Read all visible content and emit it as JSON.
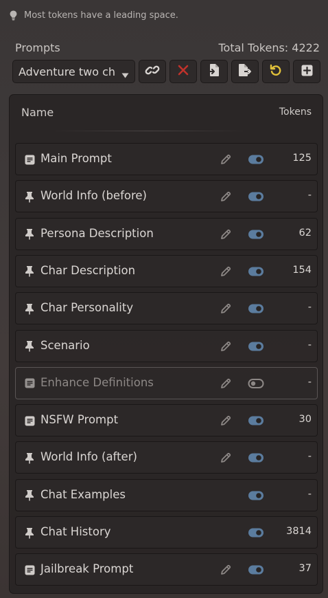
{
  "hint": {
    "text": "Most tokens have a leading space.",
    "icon": "lightbulb-icon"
  },
  "header": {
    "title": "Prompts",
    "total": "Total Tokens: 4222"
  },
  "toolbar": {
    "selected_preset": "Adventure two chars",
    "buttons": [
      {
        "icon": "link-icon",
        "color": "#d8d4d1"
      },
      {
        "icon": "delete-x-icon",
        "color": "#c0322b"
      },
      {
        "icon": "import-file-icon",
        "color": "#d8d4d1"
      },
      {
        "icon": "export-file-icon",
        "color": "#d8d4d1"
      },
      {
        "icon": "reset-undo-icon",
        "color": "#e2c23a"
      },
      {
        "icon": "add-square-icon",
        "color": "#d8d4d1"
      }
    ]
  },
  "table": {
    "name_header": "Name",
    "tokens_header": "Tokens",
    "rows": [
      {
        "icon": "text-doc-icon",
        "label": "Main Prompt",
        "editable": true,
        "enabled": true,
        "tokens": "125"
      },
      {
        "icon": "pin-icon",
        "label": "World Info (before)",
        "editable": true,
        "enabled": true,
        "tokens": "-"
      },
      {
        "icon": "pin-icon",
        "label": "Persona Description",
        "editable": true,
        "enabled": true,
        "tokens": "62"
      },
      {
        "icon": "pin-icon",
        "label": "Char Description",
        "editable": true,
        "enabled": true,
        "tokens": "154"
      },
      {
        "icon": "pin-icon",
        "label": "Char Personality",
        "editable": true,
        "enabled": true,
        "tokens": "-"
      },
      {
        "icon": "pin-icon",
        "label": "Scenario",
        "editable": true,
        "enabled": true,
        "tokens": "-"
      },
      {
        "icon": "text-doc-icon",
        "label": "Enhance Definitions",
        "editable": true,
        "enabled": false,
        "tokens": "-"
      },
      {
        "icon": "text-doc-icon",
        "label": "NSFW Prompt",
        "editable": true,
        "enabled": true,
        "tokens": "30"
      },
      {
        "icon": "pin-icon",
        "label": "World Info (after)",
        "editable": true,
        "enabled": true,
        "tokens": "-"
      },
      {
        "icon": "pin-icon",
        "label": "Chat Examples",
        "editable": false,
        "enabled": true,
        "tokens": "-"
      },
      {
        "icon": "pin-icon",
        "label": "Chat History",
        "editable": false,
        "enabled": true,
        "tokens": "3814"
      },
      {
        "icon": "text-doc-icon",
        "label": "Jailbreak Prompt",
        "editable": true,
        "enabled": true,
        "tokens": "37"
      }
    ]
  },
  "colors": {
    "toggle_on": "#5b7c9e",
    "toggle_off": "#8d8886",
    "danger": "#c0322b",
    "warning": "#e2c23a"
  }
}
